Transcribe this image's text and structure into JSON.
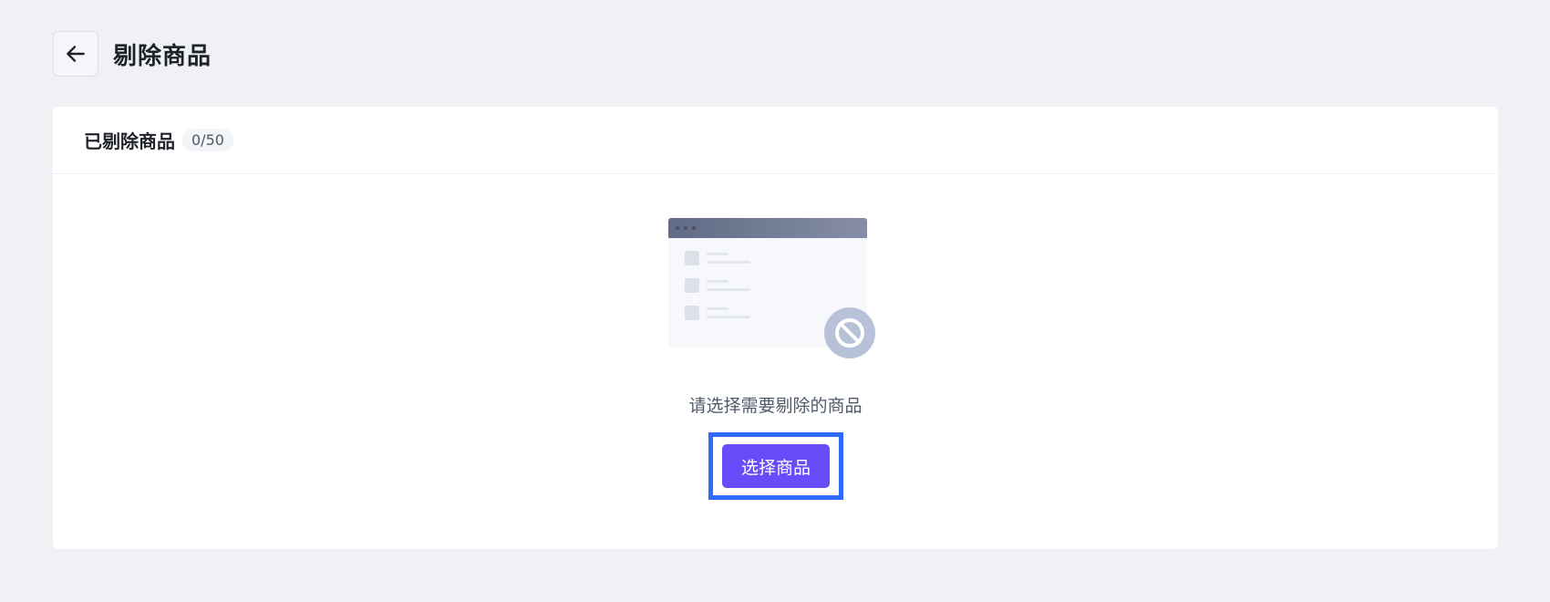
{
  "header": {
    "title": "剔除商品",
    "back_icon": "arrow-left-icon"
  },
  "card": {
    "title": "已剔除商品",
    "count": "0/50"
  },
  "empty": {
    "illustration_icon": "empty-list-illustration",
    "blocked_icon": "no-entry-icon",
    "message": "请选择需要剔除的商品",
    "button_label": "选择商品"
  },
  "colors": {
    "accent": "#6a4bfa",
    "highlight": "#2f6bff",
    "background": "#f0f1f5"
  }
}
